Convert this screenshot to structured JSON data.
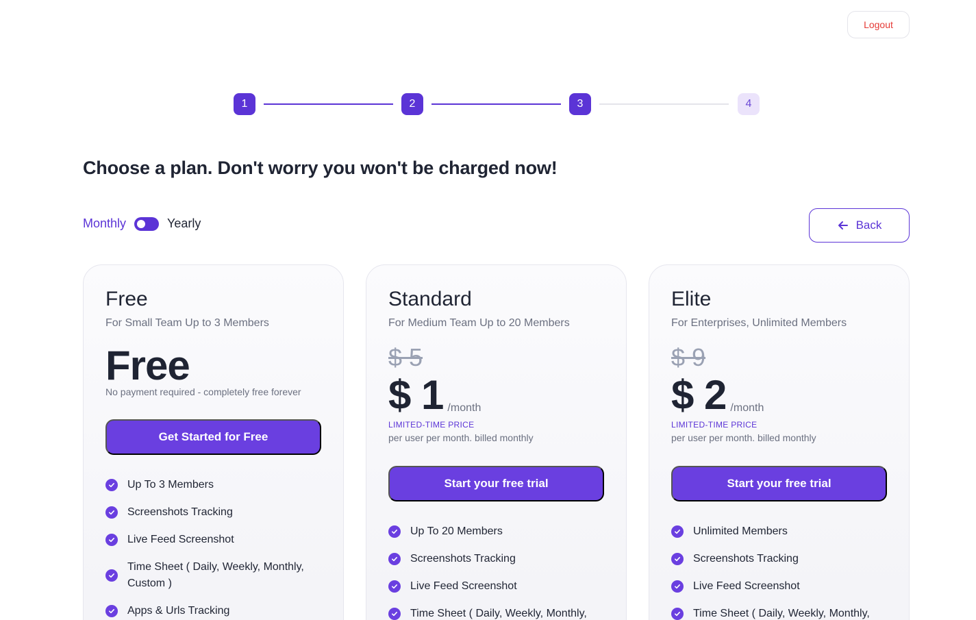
{
  "header": {
    "logout_label": "Logout"
  },
  "stepper": {
    "steps": [
      "1",
      "2",
      "3",
      "4"
    ],
    "current_step": 3
  },
  "page_title": "Choose a plan. Don't worry you won't be charged now!",
  "billing": {
    "monthly_label": "Monthly",
    "yearly_label": "Yearly",
    "selected": "Monthly"
  },
  "back_label": "Back",
  "colors": {
    "accent": "#5b34d6",
    "button": "#6a3fe0",
    "logout": "#e53935"
  },
  "plans": [
    {
      "name": "Free",
      "description": "For Small Team Up to 3 Members",
      "price_display": "Free",
      "note": "No payment required - completely free forever",
      "cta": "Get Started for Free",
      "features": [
        "Up To 3 Members",
        "Screenshots Tracking",
        "Live Feed Screenshot",
        "Time Sheet ( Daily, Weekly, Monthly, Custom )",
        "Apps & Urls Tracking"
      ]
    },
    {
      "name": "Standard",
      "description": "For Medium Team Up to 20 Members",
      "old_price": "$ 5",
      "price": "$ 1",
      "per": "/month",
      "promo": "LIMITED-TIME PRICE",
      "billing_note": "per user per month. billed monthly",
      "cta": "Start your free trial",
      "features": [
        "Up To 20 Members",
        "Screenshots Tracking",
        "Live Feed Screenshot",
        "Time Sheet ( Daily, Weekly, Monthly,"
      ]
    },
    {
      "name": "Elite",
      "description": "For Enterprises, Unlimited Members",
      "old_price": "$ 9",
      "price": "$ 2",
      "per": "/month",
      "promo": "LIMITED-TIME PRICE",
      "billing_note": "per user per month. billed monthly",
      "cta": "Start your free trial",
      "features": [
        "Unlimited Members",
        "Screenshots Tracking",
        "Live Feed Screenshot",
        "Time Sheet ( Daily, Weekly, Monthly,"
      ]
    }
  ]
}
